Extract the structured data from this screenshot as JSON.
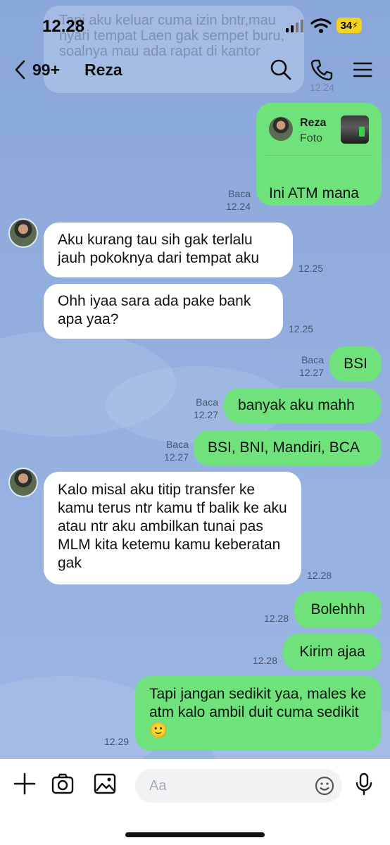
{
  "status": {
    "time": "12.28",
    "battery": "34"
  },
  "ghost": {
    "text": "Tapi aku keluar cuma izin bntr,mau nyari tempat Laen gak sempet buru, soalnya mau ada rapat di kantor",
    "time": "12.24"
  },
  "header": {
    "back_count": "99+",
    "contact_name": "Reza"
  },
  "reply": {
    "name": "Reza",
    "sub": "Foto",
    "text": "Ini ATM mana",
    "read": "Baca",
    "time": "12.24"
  },
  "messages": [
    {
      "dir": "in",
      "text": "Aku kurang tau sih gak terlalu jauh pokoknya dari tempat aku",
      "time": "12.25"
    },
    {
      "dir": "in",
      "text": "Ohh iyaa sara ada pake bank apa yaa?",
      "time": "12.25"
    },
    {
      "dir": "out",
      "text": "BSI",
      "read": "Baca",
      "time": "12.27"
    },
    {
      "dir": "out",
      "text": "banyak aku mahh",
      "read": "Baca",
      "time": "12.27"
    },
    {
      "dir": "out",
      "text": "BSI, BNI, Mandiri, BCA",
      "read": "Baca",
      "time": "12.27"
    },
    {
      "dir": "in",
      "text": "Kalo misal aku titip transfer ke kamu terus ntr kamu tf balik ke aku atau ntr aku ambilkan tunai pas MLM kita ketemu kamu keberatan gak",
      "time": "12.28"
    },
    {
      "dir": "out",
      "text": "Bolehhh",
      "time": "12.28"
    },
    {
      "dir": "out",
      "text": "Kirim ajaa",
      "time": "12.28"
    },
    {
      "dir": "out",
      "text": "Tapi jangan sedikit yaa, males ke atm kalo ambil duit cuma sedikit 🙂",
      "time": "12.29"
    }
  ],
  "composer": {
    "placeholder": "Aa"
  },
  "icons": {
    "back": "chevron-left-icon",
    "search": "search-icon",
    "call": "phone-icon",
    "menu": "menu-icon",
    "add": "plus-icon",
    "camera": "camera-icon",
    "gallery": "image-icon",
    "emoji": "emoji-icon",
    "mic": "mic-icon"
  },
  "colors": {
    "chat_bg": "#8fabdc",
    "outgoing": "#6fe27c",
    "incoming": "#ffffff",
    "battery": "#f2d21f"
  }
}
